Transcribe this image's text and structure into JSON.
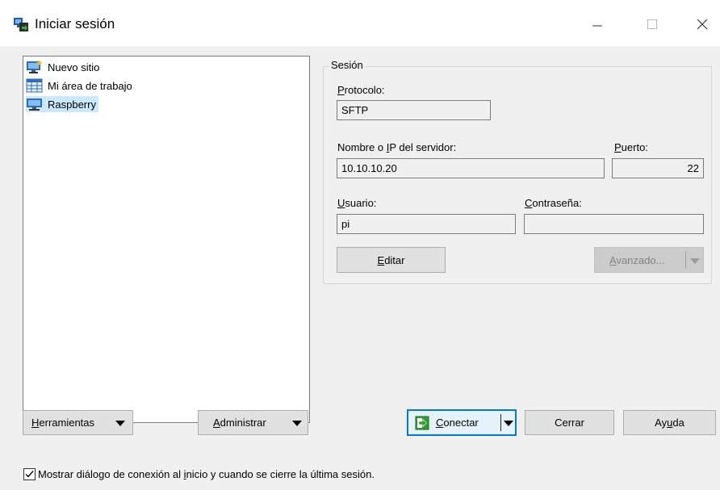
{
  "window": {
    "title": "Iniciar sesión",
    "controls": {
      "minimize": "—",
      "maximize": "☐",
      "close": "✕"
    }
  },
  "sites_tree": {
    "items": [
      {
        "label": "Nuevo sitio",
        "icon": "new-site-monitor-icon",
        "selected": false
      },
      {
        "label": "Mi área de trabajo",
        "icon": "workspace-grid-icon",
        "selected": false
      },
      {
        "label": "Raspberry",
        "icon": "monitor-icon",
        "selected": true
      }
    ]
  },
  "session": {
    "group_label": "Sesión",
    "protocol": {
      "label_pre": "",
      "label_key": "P",
      "label_post": "rotocolo:",
      "value": "SFTP"
    },
    "host": {
      "label_pre": "Nombre o ",
      "label_key": "I",
      "label_post": "P del servidor:",
      "value": "10.10.10.20"
    },
    "port": {
      "label_pre": "",
      "label_key": "P",
      "label_post": "uerto:",
      "value": "22"
    },
    "user": {
      "label_pre": "",
      "label_key": "U",
      "label_post": "suario:",
      "value": "pi"
    },
    "password": {
      "label_pre": "",
      "label_key": "C",
      "label_post": "ontraseña:",
      "value": ""
    },
    "edit_button": {
      "pre": "",
      "key": "E",
      "post": "ditar"
    },
    "advanced_button": {
      "pre": "",
      "key": "A",
      "post": "vanzado...",
      "enabled": false
    }
  },
  "bottom_buttons": {
    "tools": {
      "pre": "",
      "key": "H",
      "post": "erramientas"
    },
    "manage": {
      "pre": "",
      "key": "A",
      "post": "dministrar"
    },
    "connect": {
      "pre": "",
      "key": "C",
      "post": "onectar",
      "icon": "connect-arrow-icon"
    },
    "close": "Cerrar",
    "help": {
      "pre": "Ay",
      "key": "u",
      "post": "da"
    }
  },
  "show_dialog_checkbox": {
    "checked": true,
    "pre": "Mostrar diálogo de conexión al ",
    "key": "i",
    "post": "nicio y cuando se cierre la última sesión."
  },
  "colors": {
    "accent": "#0078d7",
    "selection": "#cce8ff",
    "connect_icon": "#2e9d2e"
  }
}
